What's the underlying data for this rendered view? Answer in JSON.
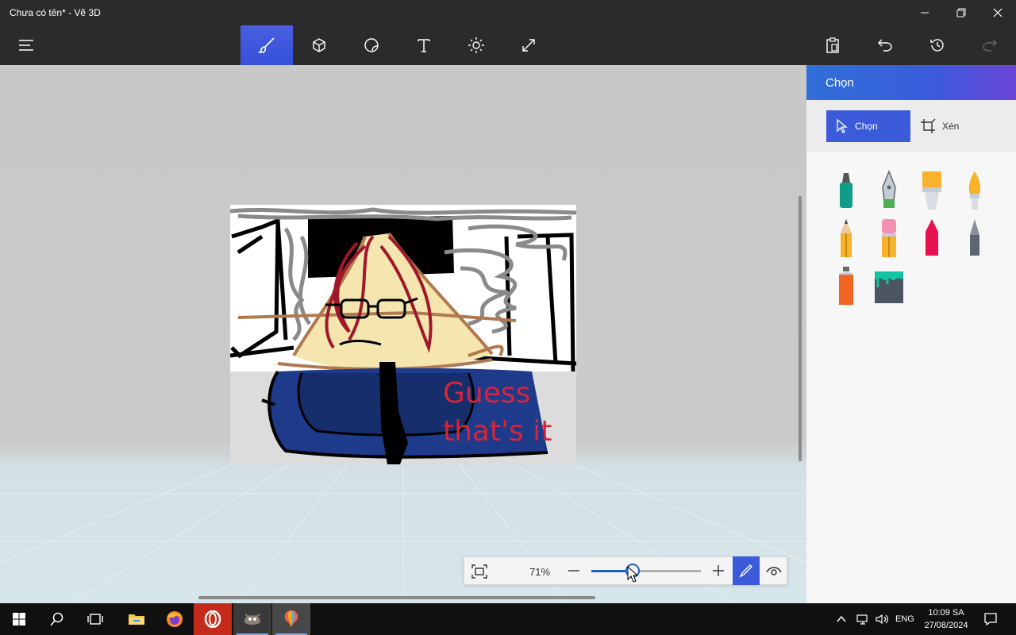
{
  "window": {
    "title": "Chưa có tên* - Vẽ 3D"
  },
  "toolbar": {
    "tools": [
      "brushes",
      "3d-shapes",
      "stickers",
      "text",
      "effects",
      "canvas"
    ],
    "active_tool": "brushes"
  },
  "canvas": {
    "drawn_text_line1": "Guess",
    "drawn_text_line2": "that's it",
    "drawn_text_color": "#d6243b"
  },
  "zoom": {
    "percent_label": "71%",
    "level": 0.38
  },
  "panel": {
    "title": "Chọn",
    "select_label": "Chọn",
    "crop_label": "Xén",
    "brushes": [
      "marker",
      "calligraphy-pen",
      "oil-brush",
      "watercolor",
      "pencil",
      "eraser",
      "crayon",
      "pixel-pen",
      "spray-can",
      "fill"
    ]
  },
  "taskbar": {
    "lang": "ENG",
    "time": "10:09 SA",
    "date": "27/08/2024"
  },
  "colors": {
    "accent": "#3b5bdb",
    "chrome": "#2b2b2b",
    "taskbar": "#101010"
  }
}
